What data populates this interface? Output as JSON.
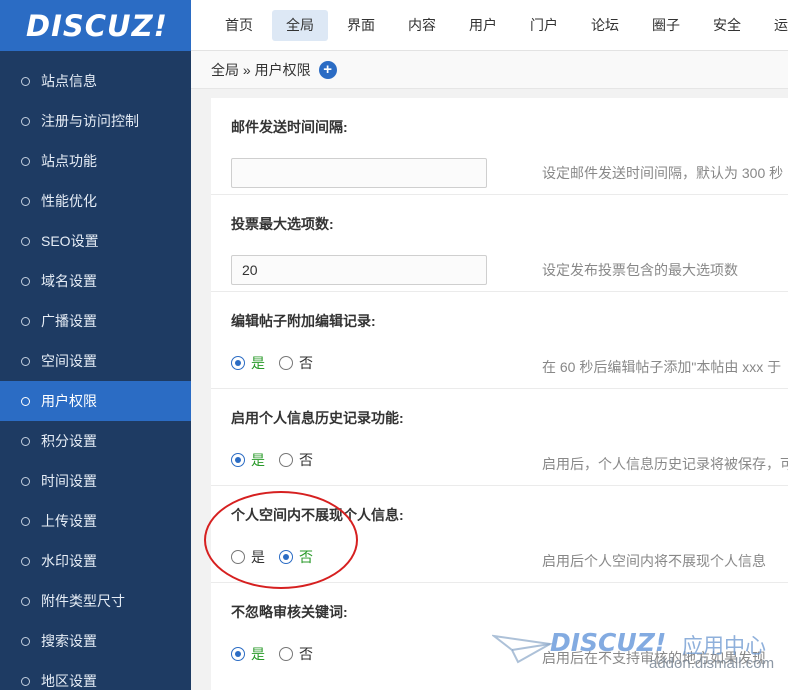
{
  "logo": {
    "text": "DISCUZ!"
  },
  "sidebar": {
    "items": [
      {
        "label": "站点信息"
      },
      {
        "label": "注册与访问控制"
      },
      {
        "label": "站点功能"
      },
      {
        "label": "性能优化"
      },
      {
        "label": "SEO设置"
      },
      {
        "label": "域名设置"
      },
      {
        "label": "广播设置"
      },
      {
        "label": "空间设置"
      },
      {
        "label": "用户权限",
        "active": true
      },
      {
        "label": "积分设置"
      },
      {
        "label": "时间设置"
      },
      {
        "label": "上传设置"
      },
      {
        "label": "水印设置"
      },
      {
        "label": "附件类型尺寸"
      },
      {
        "label": "搜索设置"
      },
      {
        "label": "地区设置"
      }
    ]
  },
  "topnav": {
    "tabs": [
      {
        "label": "首页"
      },
      {
        "label": "全局",
        "active": true
      },
      {
        "label": "界面"
      },
      {
        "label": "内容"
      },
      {
        "label": "用户"
      },
      {
        "label": "门户"
      },
      {
        "label": "论坛"
      },
      {
        "label": "圈子"
      },
      {
        "label": "安全"
      },
      {
        "label": "运营"
      }
    ]
  },
  "breadcrumb": {
    "text": "全局 » 用户权限",
    "add_icon": "plus-circle-icon"
  },
  "settings": {
    "mail_interval": {
      "title": "邮件发送时间间隔:",
      "value": "",
      "hint": "设定邮件发送时间间隔，默认为 300 秒"
    },
    "poll_max": {
      "title": "投票最大选项数:",
      "value": "20",
      "hint": "设定发布投票包含的最大选项数"
    },
    "edit_record": {
      "title": "编辑帖子附加编辑记录:",
      "yes": "是",
      "no": "否",
      "selected": "yes",
      "hint": "在 60 秒后编辑帖子添加\"本帖由 xxx 于"
    },
    "profile_history": {
      "title": "启用个人信息历史记录功能:",
      "yes": "是",
      "no": "否",
      "selected": "yes",
      "hint": "启用后，个人信息历史记录将被保存，可"
    },
    "hide_profile": {
      "title": "个人空间内不展现个人信息:",
      "yes": "是",
      "no": "否",
      "selected": "no",
      "hint": "启用后个人空间内将不展现个人信息"
    },
    "censor_keywords": {
      "title": "不忽略审核关键词:",
      "yes": "是",
      "no": "否",
      "selected": "yes",
      "hint": "启用后在不支持审核的地方如果发现"
    }
  },
  "watermark": {
    "logo": "DISCUZ!",
    "cn": "应用中心",
    "url": "addon.dismall.com"
  },
  "colors": {
    "sidebar_bg": "#1e3b63",
    "accent": "#2b6cc4",
    "checked_text": "#2a9a2a",
    "annotation": "#d62020"
  }
}
